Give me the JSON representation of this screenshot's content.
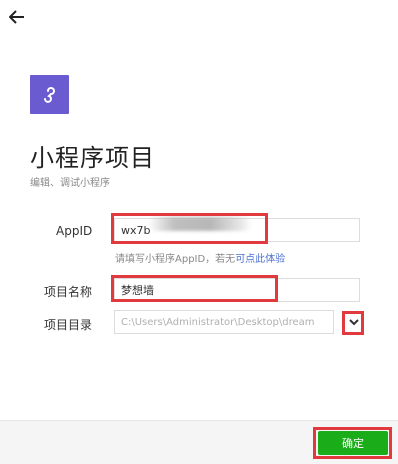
{
  "logo": {
    "icon": "mini-program-icon",
    "bg_color": "#6a5bd0"
  },
  "header": {
    "title": "小程序项目",
    "subtitle": "编辑、调试小程序"
  },
  "form": {
    "appid": {
      "label": "AppID",
      "value": "wx7b"
    },
    "hint": {
      "text": "请填写小程序AppID，若无",
      "link": "可点此体验"
    },
    "project_name": {
      "label": "项目名称",
      "value": "梦想墙"
    },
    "project_dir": {
      "label": "项目目录",
      "value": "C:\\Users\\Administrator\\Desktop\\dream"
    }
  },
  "footer": {
    "confirm_label": "确定"
  },
  "colors": {
    "accent_green": "#1aad19",
    "highlight_red": "#e0393e",
    "link_blue": "#4a6fd1"
  }
}
